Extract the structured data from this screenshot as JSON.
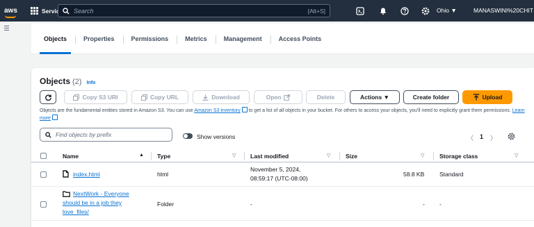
{
  "topnav": {
    "logo": "aws",
    "services_label": "Services",
    "search_placeholder": "Search",
    "search_shortcut": "[Alt+S]",
    "region": "Ohio ▼",
    "account": "MANASWINI%20CHIT"
  },
  "tabs": [
    {
      "label": "Objects",
      "active": true
    },
    {
      "label": "Properties"
    },
    {
      "label": "Permissions"
    },
    {
      "label": "Metrics"
    },
    {
      "label": "Management"
    },
    {
      "label": "Access Points"
    }
  ],
  "objects": {
    "title": "Objects",
    "count": "(2)",
    "info": "Info",
    "buttons": {
      "copy_s3_uri": "Copy S3 URI",
      "copy_url": "Copy URL",
      "download": "Download",
      "open": "Open",
      "delete": "Delete",
      "actions": "Actions ▼",
      "create_folder": "Create folder",
      "upload": "Upload"
    },
    "description_part1": "Objects are the fundamental entities stored in Amazon S3. You can use ",
    "description_link1": "Amazon S3 inventory",
    "description_part2": " to get a list of all objects in your bucket. For others to access your objects, you'll need to explicitly grant them permissions. ",
    "description_link2": "Learn more",
    "search_placeholder": "Find objects by prefix",
    "show_versions": "Show versions",
    "page": "1"
  },
  "table": {
    "columns": [
      "Name",
      "Type",
      "Last modified",
      "Size",
      "Storage class"
    ],
    "rows": [
      {
        "name": "index.html",
        "type": "html",
        "modified_line1": "November 5, 2024,",
        "modified_line2": "08:59:17 (UTC-08:00)",
        "size": "58.8 KB",
        "storage": "Standard"
      },
      {
        "name_line1": "NextWork - Everyone",
        "name_line2": "should be in a job they",
        "name_line3": "love_files/",
        "type": "Folder",
        "modified": "-",
        "size": "-",
        "storage": "-"
      }
    ]
  }
}
